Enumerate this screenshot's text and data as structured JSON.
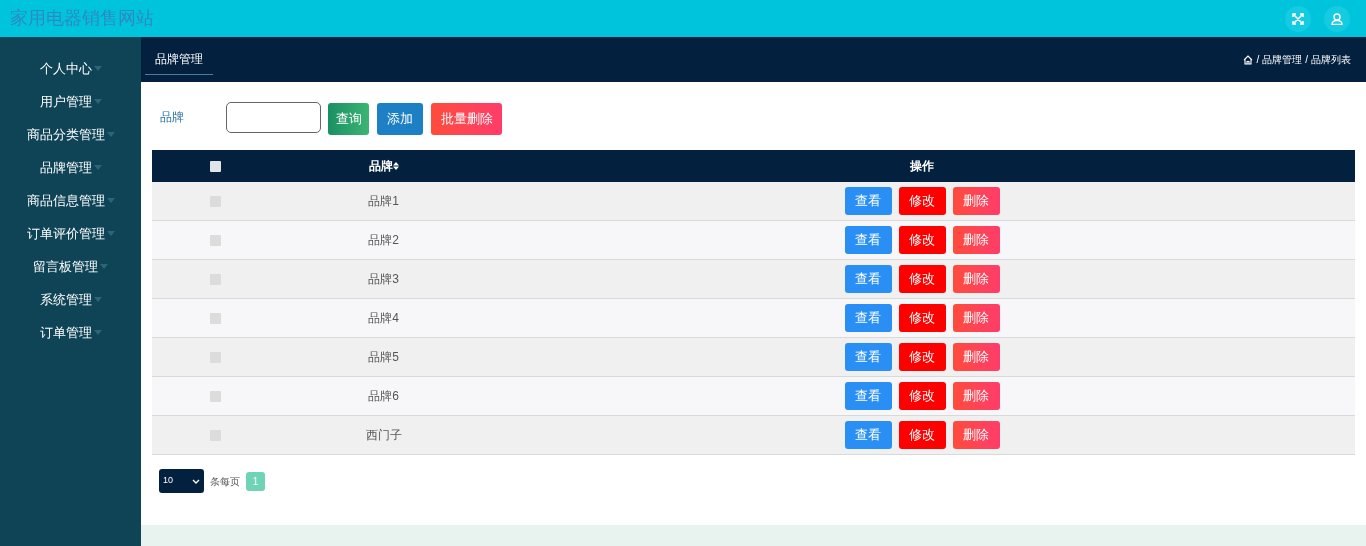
{
  "header": {
    "title": "家用电器销售网站"
  },
  "sidebar": {
    "items": [
      {
        "label": "个人中心"
      },
      {
        "label": "用户管理"
      },
      {
        "label": "商品分类管理"
      },
      {
        "label": "品牌管理"
      },
      {
        "label": "商品信息管理"
      },
      {
        "label": "订单评价管理"
      },
      {
        "label": "留言板管理"
      },
      {
        "label": "系统管理"
      },
      {
        "label": "订单管理"
      }
    ]
  },
  "tab": {
    "label": "品牌管理",
    "selected": true
  },
  "breadcrumb": [
    {
      "separator": "/",
      "label": "品牌管理"
    },
    {
      "separator": "/",
      "label": "品牌列表"
    }
  ],
  "search": {
    "label": "品牌",
    "buttons": [
      {
        "label": "查询",
        "kind": "search"
      },
      {
        "label": "添加",
        "kind": "add"
      },
      {
        "label": "批量删除",
        "kind": "bulk-delete"
      }
    ]
  },
  "table": {
    "select_all": {
      "checked": false
    },
    "columns": [
      "品牌",
      "操作"
    ],
    "rows": [
      {
        "checked": false,
        "brand": "品牌1",
        "actions": [
          "查看",
          "修改",
          "删除"
        ]
      },
      {
        "checked": false,
        "brand": "品牌2",
        "actions": [
          "查看",
          "修改",
          "删除"
        ]
      },
      {
        "checked": false,
        "brand": "品牌3",
        "actions": [
          "查看",
          "修改",
          "删除"
        ]
      },
      {
        "checked": false,
        "brand": "品牌4",
        "actions": [
          "查看",
          "修改",
          "删除"
        ]
      },
      {
        "checked": false,
        "brand": "品牌5",
        "actions": [
          "查看",
          "修改",
          "删除"
        ]
      },
      {
        "checked": false,
        "brand": "品牌6",
        "actions": [
          "查看",
          "修改",
          "删除"
        ]
      },
      {
        "checked": false,
        "brand": "西门子",
        "actions": [
          "查看",
          "修改",
          "删除"
        ]
      }
    ]
  },
  "pagination": {
    "page_size": "10",
    "per_page_label": "条每页",
    "pages": [
      {
        "label": "1",
        "selected": true
      }
    ]
  }
}
